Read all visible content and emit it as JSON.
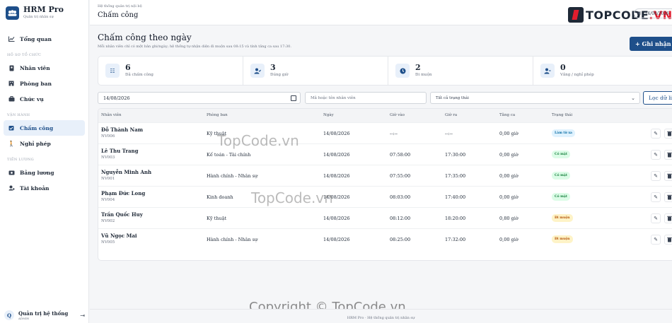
{
  "brand": {
    "name": "HRM Pro",
    "tagline": "Quản trị nhân sự"
  },
  "sidebar": {
    "items": [
      {
        "label": "Tổng quan",
        "icon": "chart-line-icon"
      },
      {
        "label": "Nhân viên",
        "icon": "id-card-icon"
      },
      {
        "label": "Phòng ban",
        "icon": "building-icon"
      },
      {
        "label": "Chức vụ",
        "icon": "briefcase-icon"
      },
      {
        "label": "Chấm công",
        "icon": "calendar-check-icon",
        "active": true
      },
      {
        "label": "Nghỉ phép",
        "icon": "person-walking-icon"
      },
      {
        "label": "Bảng lương",
        "icon": "money-icon"
      },
      {
        "label": "Tài khoản",
        "icon": "user-gear-icon"
      }
    ],
    "sections": {
      "org": "HỒ SƠ TỔ CHỨC",
      "ops": "VẬN HÀNH",
      "pay": "TIỀN LƯƠNG"
    },
    "user": {
      "initial": "Q",
      "name": "Quản trị hệ thống",
      "role": "ADMIN"
    }
  },
  "topbar": {
    "crumb": "Hệ thống quản trị nội bộ",
    "title": "Chấm công",
    "date": "14/08/2026"
  },
  "watermark": {
    "logo_main": "TOPCODE",
    "logo_suffix": ".VN",
    "mid1": "TopCode.vn",
    "mid2": "TopCode.vn",
    "copyright": "Copyright © TopCode.vn"
  },
  "page": {
    "title": "Chấm công theo ngày",
    "subtitle": "Mỗi nhân viên chỉ có một bản ghi/ngày; hệ thống tự nhận diện đi muộn sau 08:15 và tính tăng ca sau 17:30.",
    "add_button": "+ Ghi nhận công"
  },
  "stats": [
    {
      "value": "6",
      "label": "Đã chấm công",
      "icon": "list-check-icon",
      "bg": "#e8f0fa",
      "fg": "#1e4f8a"
    },
    {
      "value": "3",
      "label": "Đúng giờ",
      "icon": "user-check-icon",
      "bg": "#e8f0fa",
      "fg": "#1e4f8a"
    },
    {
      "value": "2",
      "label": "Đi muộn",
      "icon": "clock-icon",
      "bg": "#e8f0fa",
      "fg": "#1e4f8a"
    },
    {
      "value": "0",
      "label": "Vắng / nghỉ phép",
      "icon": "user-minus-icon",
      "bg": "#e8f0fa",
      "fg": "#1e4f8a"
    }
  ],
  "filters": {
    "date": "14/08/2026",
    "search_placeholder": "Mã hoặc tên nhân viên",
    "status_selected": "Tất cả trạng thái",
    "filter_button": "Lọc dữ liệu"
  },
  "table": {
    "headers": [
      "Nhân viên",
      "Phòng ban",
      "Ngày",
      "Giờ vào",
      "Giờ ra",
      "Tăng ca",
      "Trạng thái"
    ],
    "rows": [
      {
        "name": "Đỗ Thành Nam",
        "id": "NV006",
        "dept": "Kỹ thuật",
        "date": "14/08/2026",
        "in": "--:--",
        "out": "--:--",
        "ot": "0,00 giờ",
        "status": "Làm từ xa",
        "status_bg": "#e0f2fe",
        "status_fg": "#0369a1"
      },
      {
        "name": "Lê Thu Trang",
        "id": "NV003",
        "dept": "Kế toán - Tài chính",
        "date": "14/08/2026",
        "in": "07:58:00",
        "out": "17:30:00",
        "ot": "0,00 giờ",
        "status": "Có mặt",
        "status_bg": "#dcfce7",
        "status_fg": "#15803d"
      },
      {
        "name": "Nguyễn Minh Anh",
        "id": "NV001",
        "dept": "Hành chính - Nhân sự",
        "date": "14/08/2026",
        "in": "07:55:00",
        "out": "17:35:00",
        "ot": "0,00 giờ",
        "status": "Có mặt",
        "status_bg": "#dcfce7",
        "status_fg": "#15803d"
      },
      {
        "name": "Phạm Đức Long",
        "id": "NV004",
        "dept": "Kinh doanh",
        "date": "14/08/2026",
        "in": "08:03:00",
        "out": "17:40:00",
        "ot": "0,00 giờ",
        "status": "Có mặt",
        "status_bg": "#dcfce7",
        "status_fg": "#15803d"
      },
      {
        "name": "Trần Quốc Huy",
        "id": "NV002",
        "dept": "Kỹ thuật",
        "date": "14/08/2026",
        "in": "08:12:00",
        "out": "18:20:00",
        "ot": "0,80 giờ",
        "status": "Đi muộn",
        "status_bg": "#fef3c7",
        "status_fg": "#b45309"
      },
      {
        "name": "Vũ Ngọc Mai",
        "id": "NV005",
        "dept": "Hành chính - Nhân sự",
        "date": "14/08/2026",
        "in": "08:25:00",
        "out": "17:32:00",
        "ot": "0,00 giờ",
        "status": "Đi muộn",
        "status_bg": "#fef3c7",
        "status_fg": "#b45309"
      }
    ]
  },
  "footer": "HRM Pro · Hệ thống quản trị nhân sự"
}
